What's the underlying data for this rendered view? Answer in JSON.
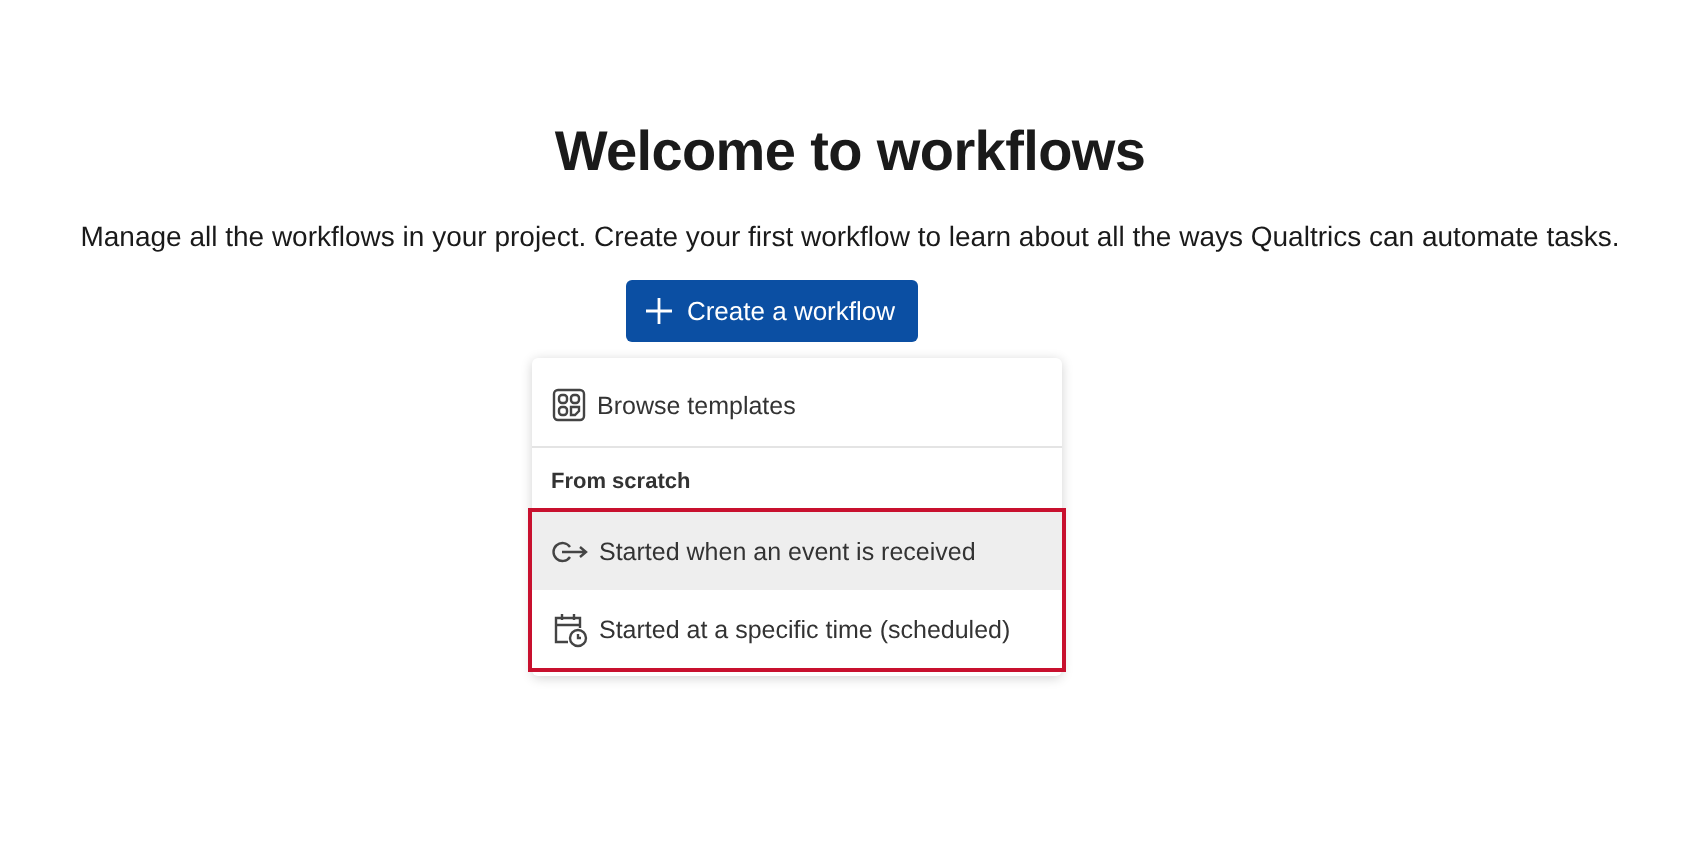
{
  "title": "Welcome to workflows",
  "description": "Manage all the workflows in your project. Create your first workflow to learn about all the ways Qualtrics can automate tasks.",
  "create_button": {
    "label": "Create a workflow"
  },
  "menu": {
    "items": [
      {
        "kind": "templates",
        "label": "Browse templates",
        "selected": false
      }
    ],
    "sections": [
      {
        "heading": "From scratch",
        "outlined": true,
        "items": [
          {
            "kind": "event",
            "label": "Started when an event is received",
            "selected": true
          },
          {
            "kind": "schedule",
            "label": "Started at a specific time (scheduled)",
            "selected": false
          }
        ]
      }
    ]
  }
}
